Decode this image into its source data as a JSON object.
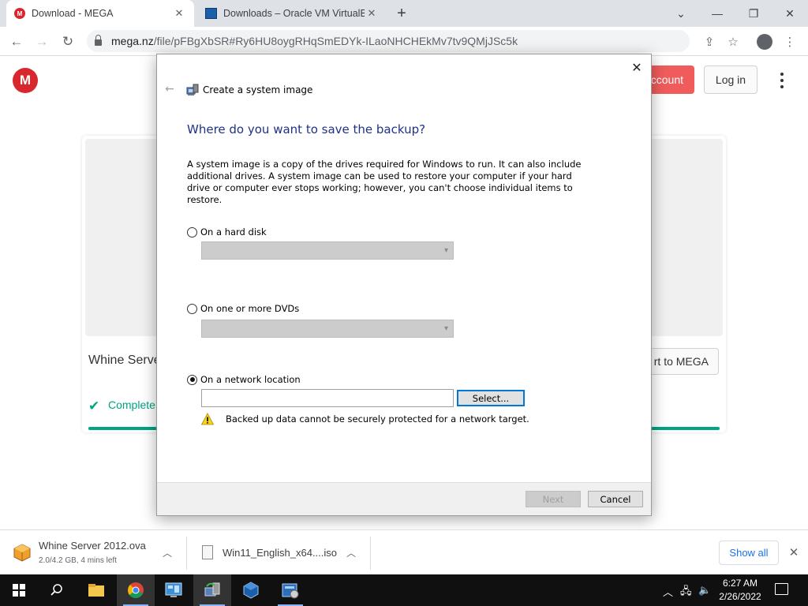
{
  "browser": {
    "tabs": [
      {
        "title": "Download - MEGA",
        "active": true
      },
      {
        "title": "Downloads – Oracle VM VirtualBox",
        "active": false
      }
    ],
    "url": {
      "host": "mega.nz",
      "path": "/file/pFBgXbSR#Ry6HU8oygRHqSmEDYk-ILaoNHCHEkMv7tv9QMjJSc5k"
    }
  },
  "mega": {
    "logo": "M",
    "create_account_label": "ccount",
    "login_label": "Log in",
    "file_name": "Whine Serve",
    "import_label": "rt to MEGA",
    "status": "Complete",
    "accent": "#00a382",
    "brand": "#d9272e"
  },
  "dialog": {
    "app_title": "Create a system image",
    "heading": "Where do you want to save the backup?",
    "description": "A system image is a copy of the drives required for Windows to run. It can also include additional drives. A system image can be used to restore your computer if your hard drive or computer ever stops working; however, you can't choose individual items to restore.",
    "options": [
      {
        "label": "On a hard disk",
        "selected": false
      },
      {
        "label": "On one or more DVDs",
        "selected": false
      },
      {
        "label": "On a network location",
        "selected": true
      }
    ],
    "network_path_value": "",
    "select_button": "Select...",
    "warning": "Backed up data cannot be securely protected for a network target.",
    "next_button": "Next",
    "cancel_button": "Cancel",
    "heading_color": "#1e3287"
  },
  "downloads": {
    "items": [
      {
        "name": "Whine Server 2012.ova",
        "status": "2.0/4.2 GB, 4 mins left",
        "icon": "virtualbox-package-icon"
      },
      {
        "name": "Win11_English_x64....iso",
        "status": "",
        "icon": "file-icon"
      }
    ],
    "show_all": "Show all"
  },
  "taskbar": {
    "apps": [
      "file-explorer-icon",
      "chrome-icon",
      "control-panel-icon",
      "backup-restore-icon",
      "virtualbox-icon",
      "settings-app-icon"
    ],
    "time": "6:27 AM",
    "date": "2/26/2022"
  }
}
